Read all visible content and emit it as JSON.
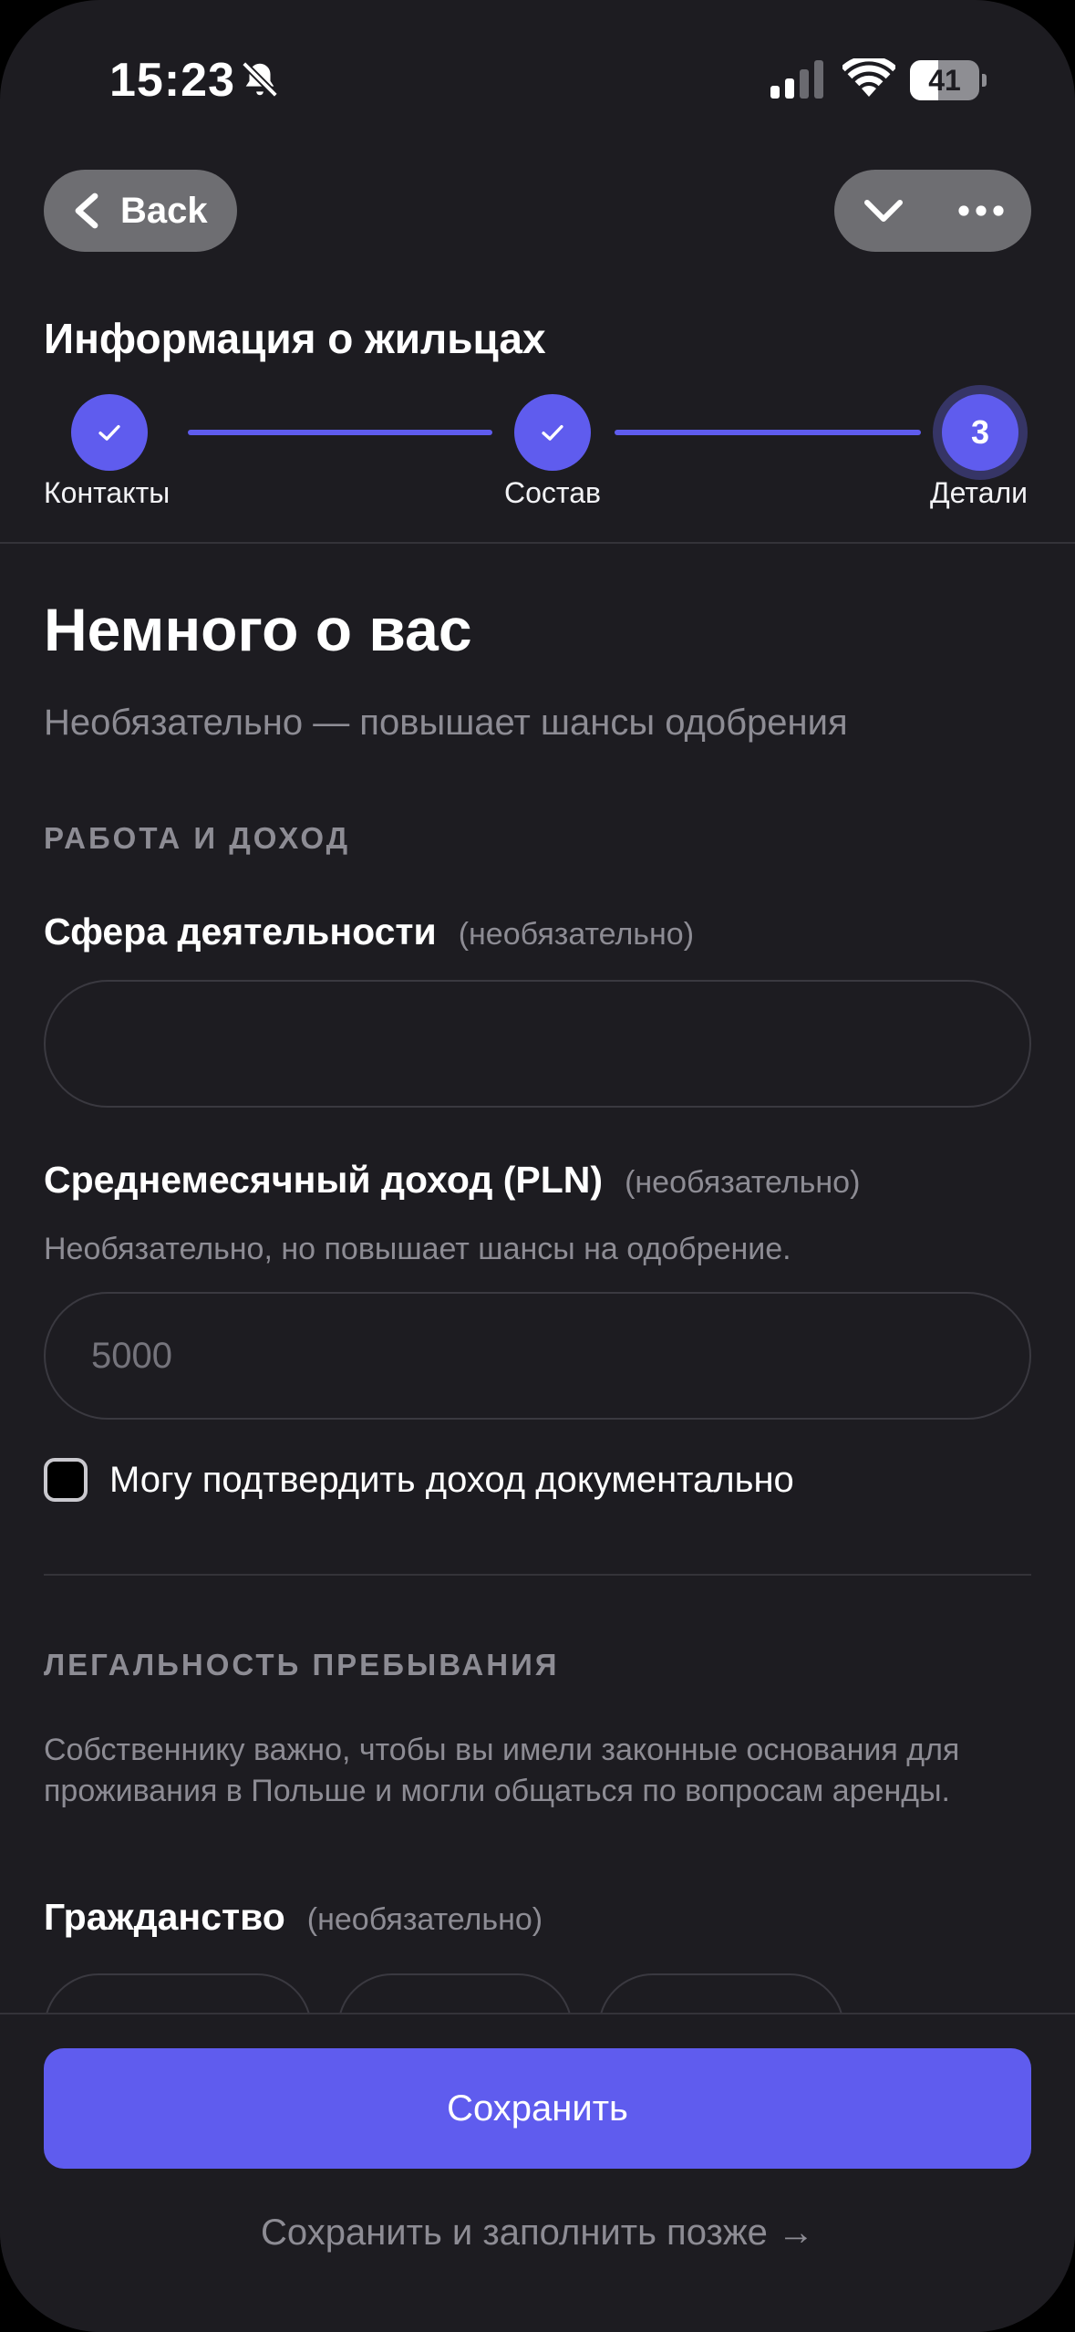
{
  "status_bar": {
    "time": "15:23",
    "battery_level": "41",
    "battery_fraction": 0.41
  },
  "nav": {
    "back_label": "Back"
  },
  "header": {
    "title": "Информация о жильцах"
  },
  "stepper": {
    "steps": [
      {
        "label": "Контакты",
        "state": "done"
      },
      {
        "label": "Состав",
        "state": "done"
      },
      {
        "label": "Детали",
        "state": "current",
        "number": "3"
      }
    ]
  },
  "form": {
    "title": "Немного о вас",
    "subtitle": "Необязательно — повышает шансы одобрения",
    "work_section_label": "РАБОТА И ДОХОД",
    "occupation": {
      "label": "Сфера деятельности",
      "optional": "(необязательно)",
      "value": "",
      "placeholder": ""
    },
    "income": {
      "label": "Среднемесячный доход (PLN)",
      "optional": "(необязательно)",
      "helper": "Необязательно, но повышает шансы на одобрение.",
      "value": "",
      "placeholder": "5000"
    },
    "income_proof_checkbox": {
      "label": "Могу подтвердить доход документально",
      "checked": false
    },
    "legal_section_label": "ЛЕГАЛЬНОСТЬ ПРЕБЫВАНИЯ",
    "legal_description": "Собственнику важно, чтобы вы имели законные основания для проживания в Польше и могли общаться по вопросам аренды.",
    "citizenship": {
      "label": "Гражданство",
      "optional": "(необязательно)"
    }
  },
  "footer": {
    "save_label": "Сохранить",
    "save_later_label": "Сохранить и заполнить позже →"
  },
  "colors": {
    "accent": "#5f5cee",
    "background": "#1d1c21",
    "muted_text": "#8d8c94"
  }
}
